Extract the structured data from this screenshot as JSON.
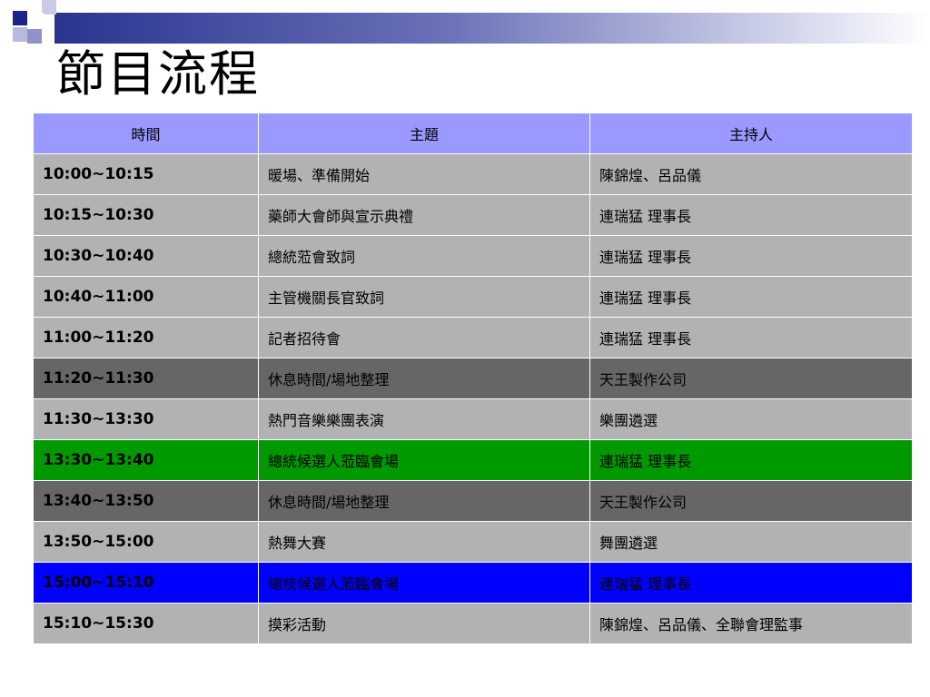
{
  "title": "節目流程",
  "colors": {
    "header_bg": "#9999ff",
    "row_gray": "#b2b2b2",
    "row_dark": "#666666",
    "row_green": "#009900",
    "row_blue": "#0000ff"
  },
  "table": {
    "headers": [
      "時間",
      "主題",
      "主持人"
    ],
    "rows": [
      {
        "time": "10:00~10:15",
        "topic": "暖場、準備開始",
        "host": "陳錦煌、呂品儀",
        "style": "gray"
      },
      {
        "time": "10:15~10:30",
        "topic": "藥師大會師與宣示典禮",
        "host": "連瑞猛 理事長",
        "style": "gray"
      },
      {
        "time": "10:30~10:40",
        "topic": "總統蒞會致詞",
        "host": "連瑞猛 理事長",
        "style": "gray"
      },
      {
        "time": "10:40~11:00",
        "topic": "主管機關長官致詞",
        "host": "連瑞猛 理事長",
        "style": "gray"
      },
      {
        "time": "11:00~11:20",
        "topic": "記者招待會",
        "host": "連瑞猛 理事長",
        "style": "gray"
      },
      {
        "time": "11:20~11:30",
        "topic": "休息時間/場地整理",
        "host": "天王製作公司",
        "style": "dark"
      },
      {
        "time": "11:30~13:30",
        "topic": "熱門音樂樂團表演",
        "host": "樂團遴選",
        "style": "gray"
      },
      {
        "time": "13:30~13:40",
        "topic": "總統候選人蒞臨會場",
        "host": "連瑞猛 理事長",
        "style": "green"
      },
      {
        "time": "13:40~13:50",
        "topic": "休息時間/場地整理",
        "host": "天王製作公司",
        "style": "dark"
      },
      {
        "time": "13:50~15:00",
        "topic": "熱舞大賽",
        "host": "舞團遴選",
        "style": "gray"
      },
      {
        "time": "15:00~15:10",
        "topic": "總統候選人蒞臨會場",
        "host": "連瑞猛 理事長",
        "style": "blue"
      },
      {
        "time": "15:10~15:30",
        "topic": "摸彩活動",
        "host": "陳錦煌、呂品儀、全聯會理監事",
        "style": "gray"
      }
    ]
  }
}
